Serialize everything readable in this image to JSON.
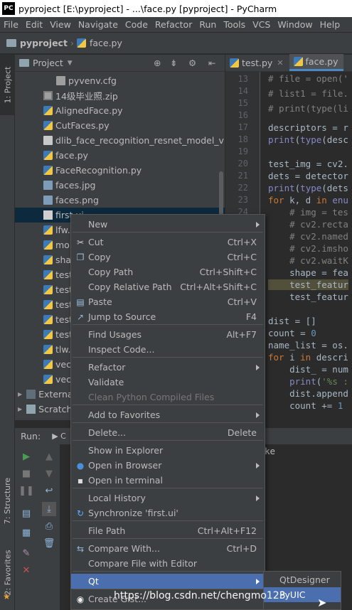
{
  "window": {
    "title": "pyproject [E:\\pyproject] - ...\\face.py [pyproject] - PyCharm",
    "logo": "PC"
  },
  "menubar": [
    "File",
    "Edit",
    "View",
    "Navigate",
    "Code",
    "Refactor",
    "Run",
    "Tools",
    "VCS",
    "Window",
    "Help"
  ],
  "breadcrumb": {
    "project": "pyproject",
    "file": "face.py"
  },
  "left_strip": {
    "project_tab": "1: Project",
    "structure_tab": "7: Structure",
    "favorites_tab": "2: Favorites"
  },
  "project_panel": {
    "title": "Project",
    "tree": [
      {
        "name": "pyvenv.cfg",
        "icon": "config-file-icon"
      },
      {
        "name": "14级毕业照.zip",
        "icon": "zip-file-icon"
      },
      {
        "name": "AlignedFace.py",
        "icon": "python-file-icon"
      },
      {
        "name": "CutFaces.py",
        "icon": "python-file-icon"
      },
      {
        "name": "dlib_face_recognition_resnet_model_v1.dat",
        "icon": "data-file-icon"
      },
      {
        "name": "face.py",
        "icon": "python-file-icon"
      },
      {
        "name": "FaceRecognition.py",
        "icon": "python-file-icon"
      },
      {
        "name": "faces.jpg",
        "icon": "image-file-icon"
      },
      {
        "name": "faces.png",
        "icon": "image-file-icon"
      },
      {
        "name": "first.ui",
        "icon": "ui-file-icon"
      },
      {
        "name": "lfw.",
        "icon": "python-file-icon"
      },
      {
        "name": "mo",
        "icon": "python-file-icon"
      },
      {
        "name": "sha",
        "icon": "python-file-icon"
      },
      {
        "name": "test",
        "icon": "python-file-icon"
      },
      {
        "name": "test",
        "icon": "python-file-icon"
      },
      {
        "name": "test",
        "icon": "python-file-icon"
      },
      {
        "name": "test",
        "icon": "python-file-icon"
      },
      {
        "name": "test",
        "icon": "python-file-icon"
      },
      {
        "name": "tlw.",
        "icon": "python-file-icon"
      },
      {
        "name": "vec",
        "icon": "python-file-icon"
      },
      {
        "name": "vec",
        "icon": "python-file-icon"
      },
      {
        "name": "Externa",
        "icon": "library-icon"
      },
      {
        "name": "Scratch",
        "icon": "scratch-icon"
      }
    ]
  },
  "editor": {
    "tabs": [
      {
        "label": "test.py"
      },
      {
        "label": "face.py"
      }
    ],
    "line_numbers": [
      "13",
      "14",
      "15",
      "16",
      "17",
      "18",
      "19",
      "20",
      "21",
      "22",
      "23",
      "24",
      "25",
      "26",
      "27",
      "28",
      "29",
      "30",
      "31",
      "32",
      "33",
      "34",
      "35",
      "36"
    ]
  },
  "run_panel": {
    "label": "Run:",
    "console_fragment": "ke"
  },
  "context_menu": {
    "items": [
      {
        "label": "New",
        "shortcut": "",
        "submenu": true
      },
      {
        "label": "Cut",
        "shortcut": "Ctrl+X",
        "icon": "scissors-icon"
      },
      {
        "label": "Copy",
        "shortcut": "Ctrl+C",
        "icon": "copy-icon"
      },
      {
        "label": "Copy Path",
        "shortcut": "Ctrl+Shift+C"
      },
      {
        "label": "Copy Relative Path",
        "shortcut": "Ctrl+Alt+Shift+C"
      },
      {
        "label": "Paste",
        "shortcut": "Ctrl+V",
        "icon": "paste-icon"
      },
      {
        "label": "Jump to Source",
        "shortcut": "F4",
        "icon": "jump-icon"
      },
      {
        "label": "Find Usages",
        "shortcut": "Alt+F7"
      },
      {
        "label": "Inspect Code...",
        "shortcut": ""
      },
      {
        "label": "Refactor",
        "shortcut": "",
        "submenu": true
      },
      {
        "label": "Validate",
        "shortcut": ""
      },
      {
        "label": "Clean Python Compiled Files",
        "shortcut": "",
        "disabled": true
      },
      {
        "label": "Add to Favorites",
        "shortcut": "",
        "submenu": true
      },
      {
        "label": "Delete...",
        "shortcut": "Delete"
      },
      {
        "label": "Show in Explorer",
        "shortcut": ""
      },
      {
        "label": "Open in Browser",
        "shortcut": "",
        "submenu": true,
        "icon": "globe-icon"
      },
      {
        "label": "Open in terminal",
        "shortcut": "",
        "icon": "terminal-icon"
      },
      {
        "label": "Local History",
        "shortcut": "",
        "submenu": true
      },
      {
        "label": "Synchronize 'first.ui'",
        "shortcut": "",
        "icon": "sync-icon"
      },
      {
        "label": "File Path",
        "shortcut": "Ctrl+Alt+F12"
      },
      {
        "label": "Compare With...",
        "shortcut": "Ctrl+D",
        "icon": "compare-icon"
      },
      {
        "label": "Compare File with Editor",
        "shortcut": ""
      },
      {
        "label": "Qt",
        "shortcut": "",
        "submenu": true,
        "selected": true
      },
      {
        "label": "Create Gist...",
        "shortcut": "",
        "icon": "github-icon"
      }
    ]
  },
  "qt_submenu": {
    "items": [
      "QtDesigner",
      "PyUIC"
    ]
  },
  "watermark": "https://blog.csdn.net/chengmo123",
  "colors": {
    "selection": "#4b6eaf",
    "background": "#2b2b2b",
    "panel": "#3c3f41"
  }
}
